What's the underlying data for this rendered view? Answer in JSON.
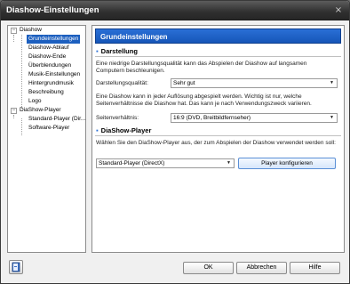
{
  "window": {
    "title": "Diashow-Einstellungen",
    "close_glyph": "×"
  },
  "tree": {
    "groups": [
      {
        "label": "Diashow",
        "items": [
          "Grundeinstellungen",
          "Diashow-Ablauf",
          "Diashow-Ende",
          "Überblendungen",
          "Musik-Einstellungen",
          "Hintergrundmusik",
          "Beschreibung",
          "Logo"
        ]
      },
      {
        "label": "DiaShow-Player",
        "items": [
          "Standard-Player (Dir...",
          "Software-Player"
        ]
      }
    ],
    "selected": "Grundeinstellungen",
    "toggle_glyph": "−"
  },
  "panel": {
    "header": "Grundeinstellungen",
    "section_darstellung": "Darstellung",
    "darstellung_text": "Eine niedrige Darstellungsqualität kann das Abspielen der Diashow auf langsamen Computern beschleunigen.",
    "quality_label": "Darstellungsqualität:",
    "quality_value": "Sehr gut",
    "aspect_text": "Eine Diashow kann in jeder Auflösung abgespielt werden. Wichtig ist nur, welche Seitenverhältnisse die Diashow hat. Das kann je nach Verwendungszweck variieren.",
    "aspect_label": "Seitenverhältnis:",
    "aspect_value": "16:9 (DVD, Breitbildfernseher)",
    "section_player": "DiaShow-Player",
    "player_text": "Wählen Sie den DiaShow-Player aus, der zum Abspielen der Diashow verwendet werden soll:",
    "player_value": "Standard-Player (DirectX)",
    "configure_button": "Player konfigurieren"
  },
  "buttons": {
    "ok": "OK",
    "cancel": "Abbrechen",
    "help": "Hilfe"
  },
  "colors": {
    "accent": "#1c5fbf",
    "header": "#1656b8",
    "titlebar": "#2f2f2f"
  }
}
